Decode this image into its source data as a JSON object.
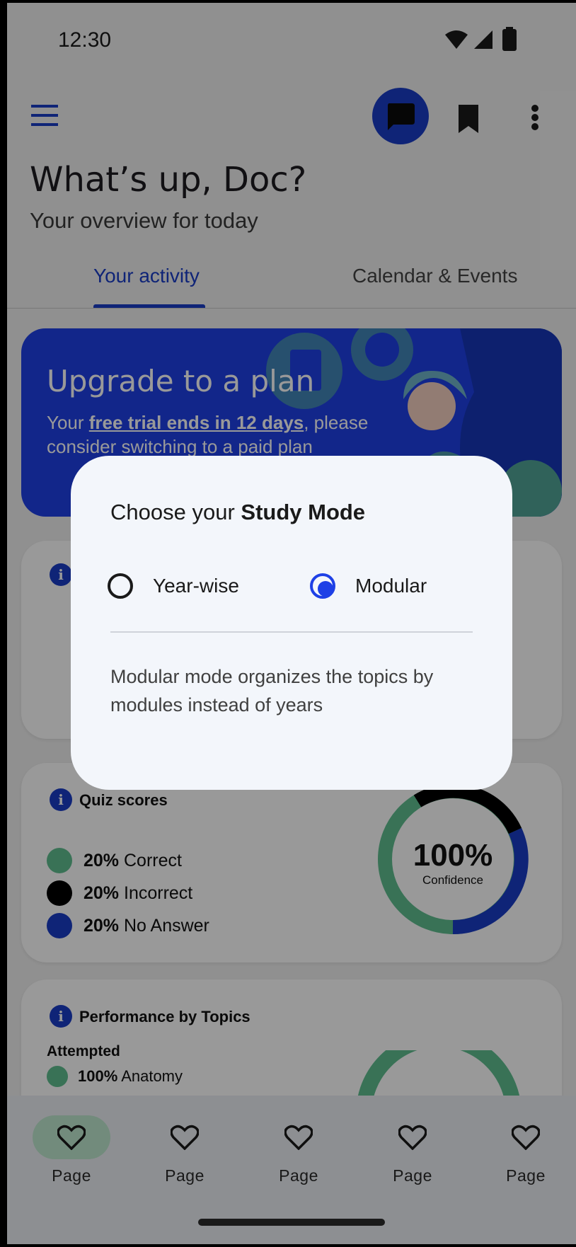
{
  "status_bar": {
    "time": "12:30"
  },
  "header": {
    "title": "What’s up, Doc?",
    "subtitle": "Your overview for today"
  },
  "tabs": [
    {
      "label": "Your activity",
      "active": true
    },
    {
      "label": "Calendar & Events",
      "active": false
    }
  ],
  "banner": {
    "title": "Upgrade to a plan",
    "text_prefix": "Your ",
    "text_bold": "free trial ends in 12 days",
    "text_suffix": ", please consider switching to a paid plan"
  },
  "quiz_card": {
    "title": "Quiz scores",
    "legend": [
      {
        "pct": "20%",
        "label": "Correct",
        "color": "#5fbf8f"
      },
      {
        "pct": "20%",
        "label": "Incorrect",
        "color": "#000000"
      },
      {
        "pct": "20%",
        "label": "No Answer",
        "color": "#1a3cc6"
      }
    ],
    "donut_value": "100%",
    "donut_label": "Confidence"
  },
  "performance_card": {
    "title": "Performance by Topics",
    "attempted_label": "Attempted",
    "topic_pct": "100%",
    "topic_name": "Anatomy"
  },
  "dialog": {
    "title_prefix": "Choose your ",
    "title_bold": "Study Mode",
    "options": [
      {
        "label": "Year-wise",
        "selected": false
      },
      {
        "label": "Modular",
        "selected": true
      }
    ],
    "description": "Modular mode organizes the topics by modules instead of years"
  },
  "bottom_nav": {
    "items": [
      {
        "label": "Page",
        "active": true
      },
      {
        "label": "Page",
        "active": false
      },
      {
        "label": "Page",
        "active": false
      },
      {
        "label": "Page",
        "active": false
      },
      {
        "label": "Page",
        "active": false
      }
    ]
  },
  "colors": {
    "primary": "#1e40e6",
    "accent_green": "#5fbf8f"
  }
}
